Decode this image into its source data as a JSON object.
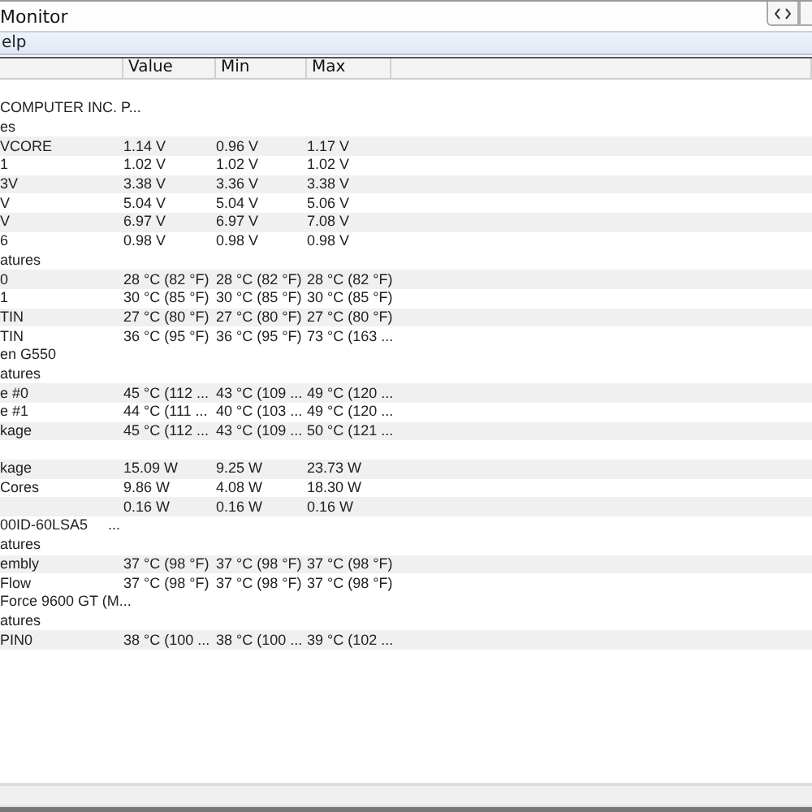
{
  "window": {
    "title": "Monitor"
  },
  "menu": [
    "elp"
  ],
  "table": {
    "columns": [
      "",
      "Value",
      "Min",
      "Max"
    ],
    "rows": [
      {
        "striped": false,
        "cells": [
          "COMPUTER INC. P..."
        ]
      },
      {
        "striped": false,
        "cells": [
          "es"
        ]
      },
      {
        "striped": true,
        "cells": [
          "VCORE",
          "1.14 V",
          "0.96 V",
          "1.17 V"
        ]
      },
      {
        "striped": false,
        "cells": [
          "1",
          "1.02 V",
          "1.02 V",
          "1.02 V"
        ]
      },
      {
        "striped": true,
        "cells": [
          "3V",
          "3.38 V",
          "3.36 V",
          "3.38 V"
        ]
      },
      {
        "striped": false,
        "cells": [
          "V",
          "5.04 V",
          "5.04 V",
          "5.06 V"
        ]
      },
      {
        "striped": true,
        "cells": [
          "V",
          "6.97 V",
          "6.97 V",
          "7.08 V"
        ]
      },
      {
        "striped": false,
        "cells": [
          "6",
          "0.98 V",
          "0.98 V",
          "0.98 V"
        ]
      },
      {
        "striped": false,
        "cells": [
          "atures"
        ]
      },
      {
        "striped": true,
        "cells": [
          "0",
          "28 °C (82 °F)",
          "28 °C (82 °F)",
          "28 °C (82 °F)"
        ]
      },
      {
        "striped": false,
        "cells": [
          "1",
          "30 °C (85 °F)",
          "30 °C (85 °F)",
          "30 °C (85 °F)"
        ]
      },
      {
        "striped": true,
        "cells": [
          "TIN",
          "27 °C (80 °F)",
          "27 °C (80 °F)",
          "27 °C (80 °F)"
        ]
      },
      {
        "striped": false,
        "cells": [
          "TIN",
          "36 °C (95 °F)",
          "36 °C (95 °F)",
          "73 °C (163 ..."
        ]
      },
      {
        "striped": false,
        "cells": [
          "en G550"
        ]
      },
      {
        "striped": false,
        "cells": [
          "atures"
        ]
      },
      {
        "striped": true,
        "cells": [
          "e #0",
          "45 °C (112 ...",
          "43 °C (109 ...",
          "49 °C (120 ..."
        ]
      },
      {
        "striped": false,
        "cells": [
          "e #1",
          "44 °C (111 ...",
          "40 °C (103 ...",
          "49 °C (120 ..."
        ]
      },
      {
        "striped": true,
        "cells": [
          "kage",
          "45 °C (112 ...",
          "43 °C (109 ...",
          "50 °C (121 ..."
        ]
      },
      {
        "striped": false,
        "cells": []
      },
      {
        "striped": true,
        "cells": [
          "kage",
          "15.09 W",
          "9.25 W",
          "23.73 W"
        ]
      },
      {
        "striped": false,
        "cells": [
          "Cores",
          "9.86 W",
          "4.08 W",
          "18.30 W"
        ]
      },
      {
        "striped": true,
        "cells": [
          "",
          "0.16 W",
          "0.16 W",
          "0.16 W"
        ]
      },
      {
        "striped": false,
        "cells": [
          "00ID-60LSA5     ..."
        ]
      },
      {
        "striped": false,
        "cells": [
          "atures"
        ]
      },
      {
        "striped": true,
        "cells": [
          "embly",
          "37 °C (98 °F)",
          "37 °C (98 °F)",
          "37 °C (98 °F)"
        ]
      },
      {
        "striped": false,
        "cells": [
          "Flow",
          "37 °C (98 °F)",
          "37 °C (98 °F)",
          "37 °C (98 °F)"
        ]
      },
      {
        "striped": false,
        "cells": [
          "Force 9600 GT (M..."
        ]
      },
      {
        "striped": false,
        "cells": [
          "atures"
        ]
      },
      {
        "striped": true,
        "cells": [
          "PIN0",
          "38 °C (100 ...",
          "38 °C (100 ...",
          "39 °C (102 ..."
        ]
      }
    ]
  }
}
